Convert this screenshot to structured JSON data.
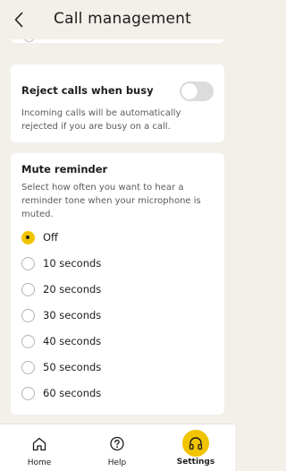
{
  "header": {
    "title": "Call management"
  },
  "reject_busy": {
    "title": "Reject calls when busy",
    "description": "Incoming calls will be automatically rejected if you are busy on a call.",
    "enabled": false
  },
  "mute_reminder": {
    "title": "Mute reminder",
    "description": "Select how often you want to hear a reminder tone when your microphone is muted.",
    "selected": "Off",
    "options": [
      "Off",
      "10 seconds",
      "20 seconds",
      "30 seconds",
      "40 seconds",
      "50 seconds",
      "60 seconds"
    ]
  },
  "nav": {
    "items": [
      {
        "label": "Home",
        "icon": "home-icon",
        "active": false
      },
      {
        "label": "Help",
        "icon": "help-icon",
        "active": false
      },
      {
        "label": "Settings",
        "icon": "headphones-icon",
        "active": true
      }
    ]
  },
  "colors": {
    "accent": "#f1c400",
    "background": "#f3f0ea",
    "card": "#ffffff"
  }
}
